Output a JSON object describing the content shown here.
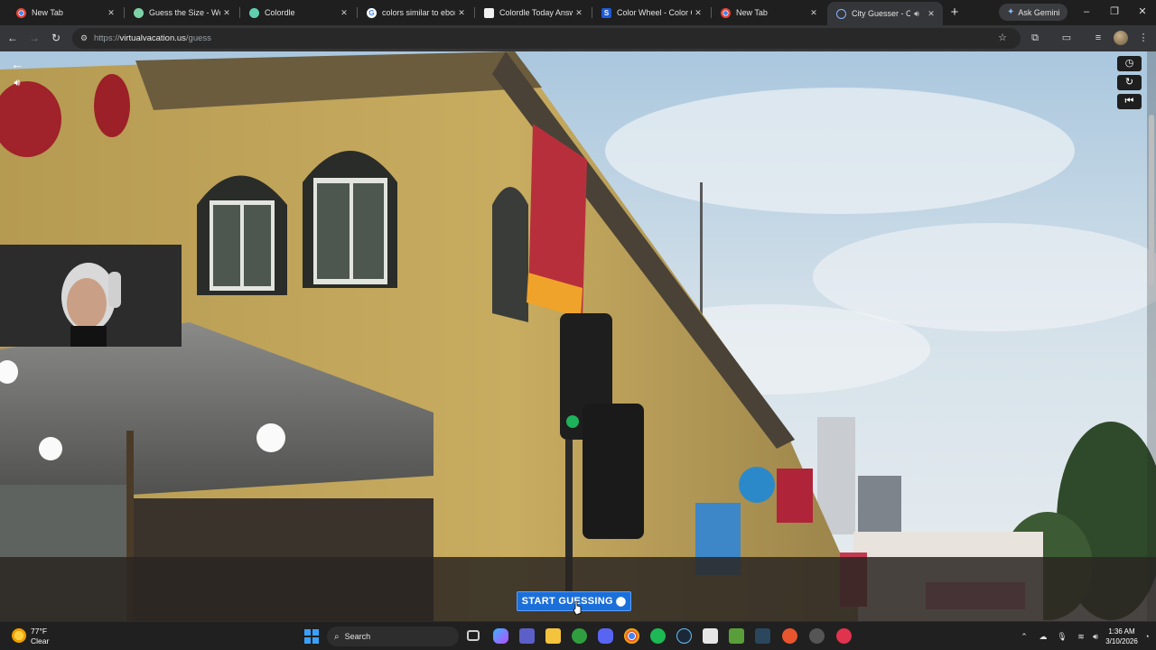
{
  "browser": {
    "tabs": [
      {
        "title": "New Tab",
        "favicon": "chrome-icon",
        "active": false
      },
      {
        "title": "Guess the Size - Worldl",
        "favicon": "worldle-icon",
        "active": false
      },
      {
        "title": "Colordle",
        "favicon": "colordle-icon",
        "active": false
      },
      {
        "title": "colors similar to ebony",
        "favicon": "google-icon",
        "active": false
      },
      {
        "title": "Colordle Today Answe",
        "favicon": "page-icon",
        "active": false
      },
      {
        "title": "Color Wheel - Color Ca",
        "favicon": "color-wheel-icon",
        "active": false
      },
      {
        "title": "New Tab",
        "favicon": "chrome-icon",
        "active": false
      },
      {
        "title": "City Guesser - Can",
        "favicon": "globe-icon",
        "active": true,
        "audio": true
      }
    ],
    "new_tab_symbol": "+",
    "gemini_label": "Ask Gemini",
    "url_scheme": "https://",
    "url_host": "virtualvacation.us",
    "url_path": "/guess"
  },
  "page": {
    "start_button_label": "START GUESSING",
    "start_button_color": "#1c6fd9"
  },
  "taskbar": {
    "weather_temp": "77°F",
    "weather_condition": "Clear",
    "search_placeholder": "Search",
    "time": "1:36 AM",
    "date": "3/10/2026"
  }
}
